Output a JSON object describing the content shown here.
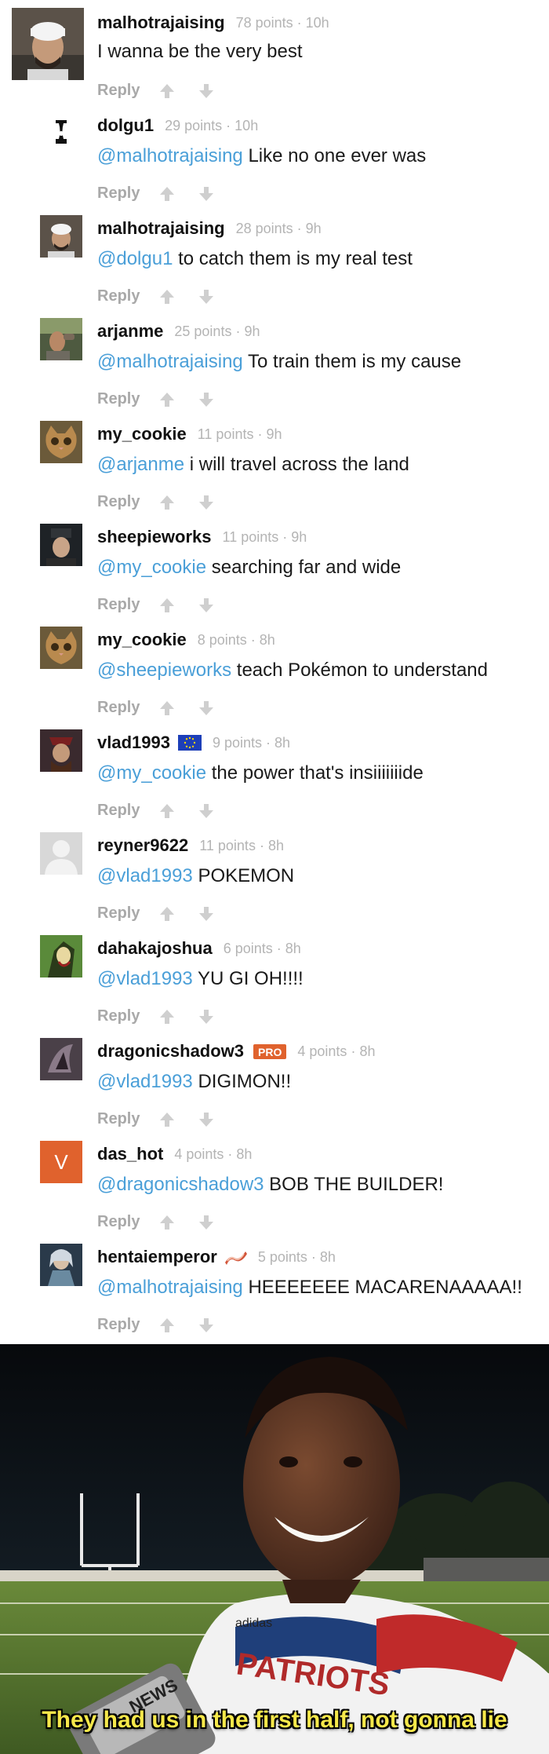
{
  "comments": [
    {
      "user": "malhotrajaising",
      "points": "78 points",
      "age": "10h",
      "mention": "",
      "text": "I wanna be the very best"
    },
    {
      "user": "dolgu1",
      "points": "29 points",
      "age": "10h",
      "mention": "@malhotrajaising",
      "text": " Like no one ever was"
    },
    {
      "user": "malhotrajaising",
      "points": "28 points",
      "age": "9h",
      "mention": "@dolgu1",
      "text": " to catch them is my real test"
    },
    {
      "user": "arjanme",
      "points": "25 points",
      "age": "9h",
      "mention": "@malhotrajaising",
      "text": " To train them is my cause"
    },
    {
      "user": "my_cookie",
      "points": "11 points",
      "age": "9h",
      "mention": "@arjanme",
      "text": " i will travel across the land"
    },
    {
      "user": "sheepieworks",
      "points": "11 points",
      "age": "9h",
      "mention": "@my_cookie",
      "text": " searching far and wide"
    },
    {
      "user": "my_cookie",
      "points": "8 points",
      "age": "8h",
      "mention": "@sheepieworks",
      "text": " teach Pokémon to understand"
    },
    {
      "user": "vlad1993",
      "points": "9 points",
      "age": "8h",
      "mention": "@my_cookie",
      "text": " the power that's insiiiiiiide"
    },
    {
      "user": "reyner9622",
      "points": "11 points",
      "age": "8h",
      "mention": "@vlad1993",
      "text": " POKEMON"
    },
    {
      "user": "dahakajoshua",
      "points": "6 points",
      "age": "8h",
      "mention": "@vlad1993",
      "text": " YU GI OH!!!!"
    },
    {
      "user": "dragonicshadow3",
      "points": "4 points",
      "age": "8h",
      "mention": "@vlad1993",
      "text": " DIGIMON!!"
    },
    {
      "user": "das_hot",
      "points": "4 points",
      "age": "8h",
      "mention": "@dragonicshadow3",
      "text": " BOB THE BUILDER!"
    },
    {
      "user": "hentaiemperor",
      "points": "5 points",
      "age": "8h",
      "mention": "@malhotrajaising",
      "text": " HEEEEEEE MACARENAAAAA!!"
    }
  ],
  "reply_label": "Reply",
  "meta_separator": " · ",
  "pro_badge": "PRO",
  "das_hot_avatar_letter": "V",
  "colors": {
    "mention": "#4a9fd8",
    "meta": "#b4b4b4",
    "action": "#a9a9a9",
    "pro": "#e0622d",
    "caption": "#f6e84a"
  },
  "icons": {
    "upvote": "arrow-up-icon",
    "downvote": "arrow-down-icon",
    "eu_flag": "eu-flag-icon",
    "bacon": "bacon-icon"
  },
  "meme": {
    "caption": "They had us in the first half, not gonna lie",
    "news_logo": "NEWS",
    "jersey_text": "PATRIOTS",
    "jersey_brand": "adidas"
  }
}
